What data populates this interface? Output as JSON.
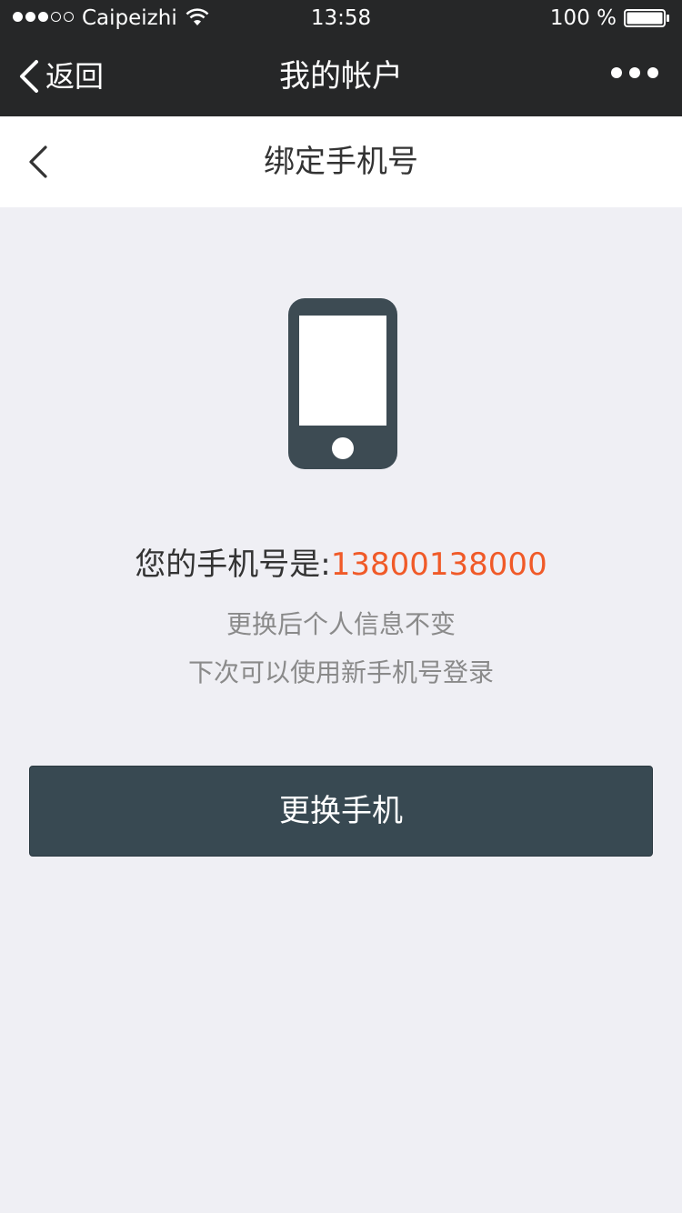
{
  "status_bar": {
    "carrier": "Caipeizhi",
    "time": "13:58",
    "battery_percent": "100 %",
    "signal_strength": {
      "filled": 3,
      "total": 5
    },
    "battery_level": 1.0
  },
  "wechat_nav": {
    "back_label": "返回",
    "title": "我的帐户",
    "more_icon": "more-dots-icon"
  },
  "page_header": {
    "title": "绑定手机号",
    "back_icon": "chevron-left-icon"
  },
  "content": {
    "illustration_icon": "smartphone-icon",
    "number_label": "您的手机号是:",
    "number_value": "13800138000",
    "hint_line_1": "更换后个人信息不变",
    "hint_line_2": "下次可以使用新手机号登录"
  },
  "actions": {
    "change_button_label": "更换手机"
  },
  "colors": {
    "dark_bar": "#262728",
    "page_background": "#efeff4",
    "accent_orange": "#f05a28",
    "button_background": "#384952",
    "illustration": "#3d4b53"
  }
}
